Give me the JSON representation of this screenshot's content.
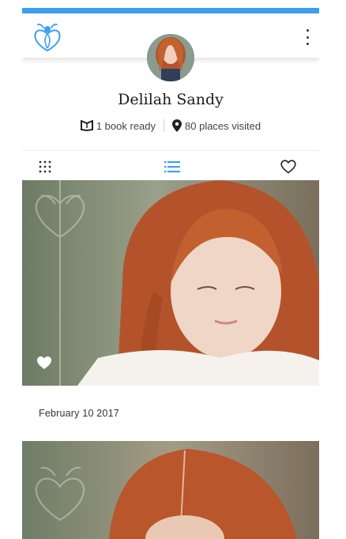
{
  "colors": {
    "accent": "#3d9ff0",
    "active_tab": "#3d9ff0",
    "text_primary": "#1b1b1b"
  },
  "appbar": {
    "logo_icon": "ladybug-heart-logo-icon",
    "menu_icon": "more-vertical-icon"
  },
  "profile": {
    "name": "Delilah Sandy",
    "avatar_alt": "profile-photo",
    "books": "1 book ready",
    "books_icon": "book-icon",
    "places": "80 places visited",
    "places_icon": "location-pin-icon"
  },
  "tabs": [
    {
      "name": "grid",
      "icon": "grid-icon",
      "active": false
    },
    {
      "name": "list",
      "icon": "list-icon",
      "active": true
    },
    {
      "name": "favorites",
      "icon": "heart-outline-icon",
      "active": false
    }
  ],
  "posts": [
    {
      "date": "February 10 2017",
      "liked": true,
      "like_icon": "heart-filled-icon"
    },
    {
      "date": ""
    }
  ]
}
